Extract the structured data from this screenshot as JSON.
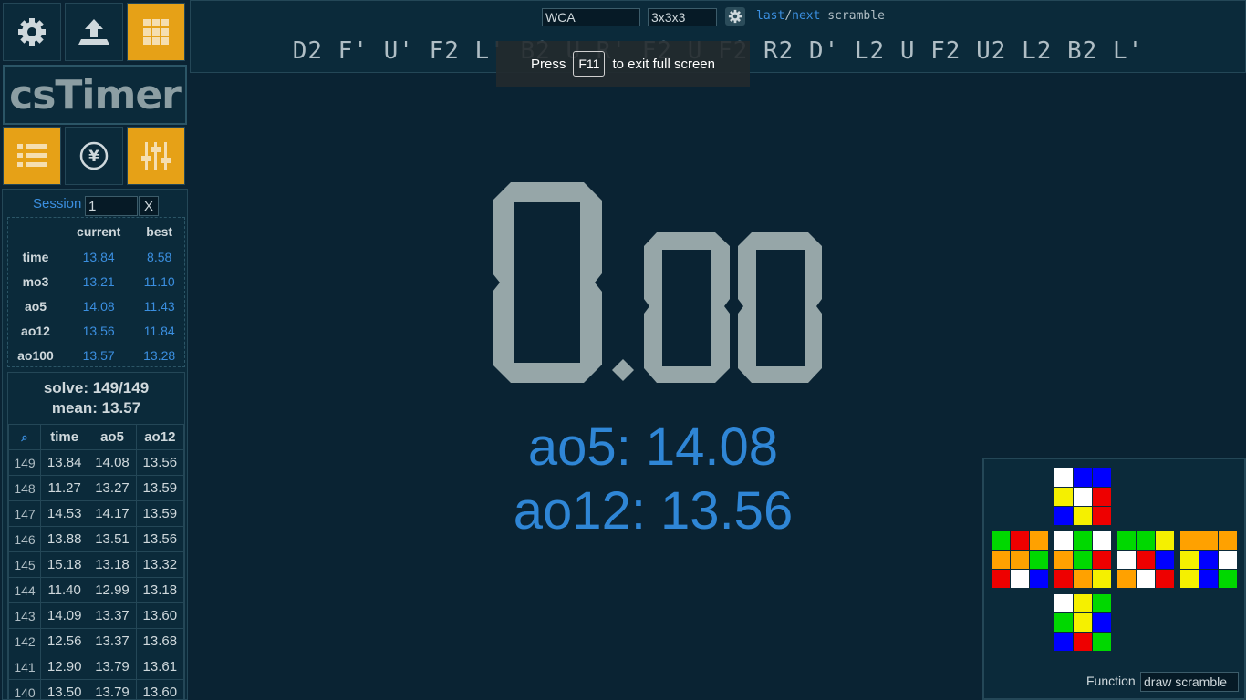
{
  "top": {
    "scramble_type": "WCA",
    "puzzle": "3x3x3",
    "last_label": "last",
    "slash": "/",
    "next_label": "next",
    "scramble_word": "scramble",
    "scramble": "D2 F' U' F2 L' B2 U R' F2 U F2 R2 D' L2 U F2 U2 L2 B2 L'"
  },
  "fullscreen_notice": {
    "press": "Press",
    "key": "F11",
    "rest": "to exit full screen"
  },
  "logo": "csTimer",
  "session": {
    "label": "Session",
    "value": "1",
    "close": "X"
  },
  "stats": {
    "headers": [
      "",
      "current",
      "best"
    ],
    "rows": [
      {
        "label": "time",
        "current": "13.84",
        "best": "8.58"
      },
      {
        "label": "mo3",
        "current": "13.21",
        "best": "11.10"
      },
      {
        "label": "ao5",
        "current": "14.08",
        "best": "11.43"
      },
      {
        "label": "ao12",
        "current": "13.56",
        "best": "11.84"
      },
      {
        "label": "ao100",
        "current": "13.57",
        "best": "13.28"
      }
    ]
  },
  "summary": {
    "solve": "solve: 149/149",
    "mean": "mean: 13.57"
  },
  "times": {
    "headers": [
      "⌕",
      "time",
      "ao5",
      "ao12"
    ],
    "rows": [
      [
        "149",
        "13.84",
        "14.08",
        "13.56"
      ],
      [
        "148",
        "11.27",
        "13.27",
        "13.59"
      ],
      [
        "147",
        "14.53",
        "14.17",
        "13.59"
      ],
      [
        "146",
        "13.88",
        "13.51",
        "13.56"
      ],
      [
        "145",
        "15.18",
        "13.18",
        "13.32"
      ],
      [
        "144",
        "11.40",
        "12.99",
        "13.18"
      ],
      [
        "143",
        "14.09",
        "13.37",
        "13.60"
      ],
      [
        "142",
        "12.56",
        "13.37",
        "13.68"
      ],
      [
        "141",
        "12.90",
        "13.79",
        "13.61"
      ],
      [
        "140",
        "13.50",
        "13.79",
        "13.60"
      ]
    ]
  },
  "timer": {
    "seconds": "0",
    "centis": "00"
  },
  "averages": {
    "ao5": "ao5: 14.08",
    "ao12": "ao12: 13.56"
  },
  "tool": {
    "function_label": "Function",
    "function_value": "draw scramble"
  },
  "colors": {
    "accent": "#3b8fe0",
    "gold": "#e6a117",
    "bg": "#0a2333",
    "panel": "#0b2a3a",
    "digits": "#96a6a8"
  },
  "icons": {
    "settings": "gear-icon",
    "export": "upload-icon",
    "grid": "grid-icon",
    "list": "list-icon",
    "donate": "yen-icon",
    "sliders": "sliders-icon"
  },
  "cube_faces": {
    "U": [
      "W",
      "B",
      "B",
      "Y",
      "W",
      "R",
      "B",
      "Y",
      "R"
    ],
    "L": [
      "G",
      "R",
      "O",
      "O",
      "O",
      "G",
      "R",
      "W",
      "B"
    ],
    "F": [
      "W",
      "G",
      "W",
      "O",
      "G",
      "R",
      "R",
      "O",
      "Y"
    ],
    "R": [
      "G",
      "G",
      "Y",
      "W",
      "R",
      "B",
      "O",
      "W",
      "R"
    ],
    "B": [
      "O",
      "O",
      "O",
      "Y",
      "B",
      "W",
      "Y",
      "B",
      "G"
    ],
    "D": [
      "W",
      "Y",
      "G",
      "G",
      "Y",
      "B",
      "B",
      "R",
      "G"
    ]
  }
}
